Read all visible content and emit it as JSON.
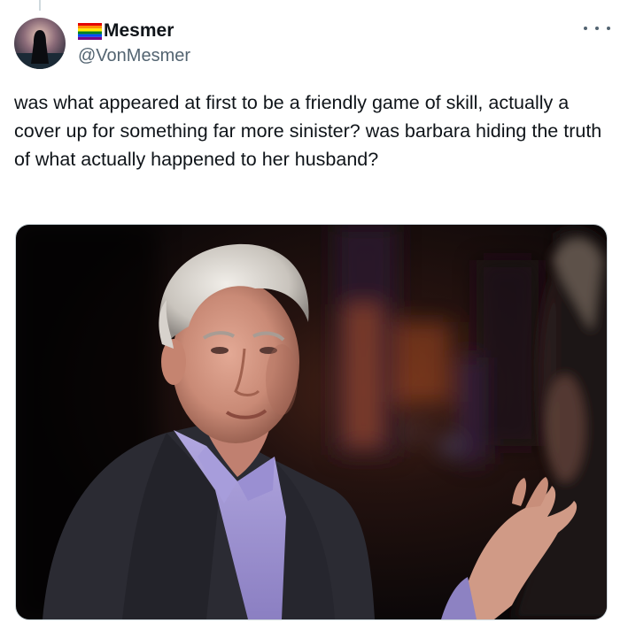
{
  "author": {
    "display_name": "Mesmer",
    "handle": "@VonMesmer"
  },
  "tweet": {
    "text": "was what appeared at first to be a friendly game of skill, actually a cover up for something far more sinister? was barbara hiding the truth of what actually happened to her husband?"
  },
  "icons": {
    "flag": "rainbow-flag-icon",
    "more": "more-options-icon"
  },
  "media": {
    "description_icon": "photo-of-gray-haired-man-in-interview"
  },
  "colors": {
    "text_primary": "#0f1419",
    "text_secondary": "#536471",
    "border": "#cfd9de"
  }
}
